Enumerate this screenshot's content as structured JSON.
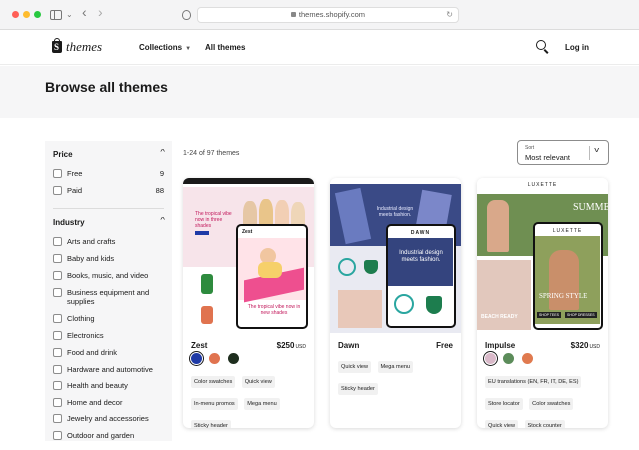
{
  "browser": {
    "url": "themes.shopify.com",
    "icons": [
      "sidebar-toggle-icon",
      "chevron-down-icon",
      "back-arrow-icon",
      "forward-arrow-icon",
      "shield-icon",
      "lock-icon",
      "reload-icon"
    ]
  },
  "header": {
    "logo_text": "themes",
    "nav": [
      {
        "label": "Collections",
        "has_dropdown": true
      },
      {
        "label": "All themes",
        "has_dropdown": false
      }
    ],
    "login_label": "Log in"
  },
  "page": {
    "title": "Browse all themes"
  },
  "filters": {
    "price": {
      "heading": "Price",
      "options": [
        {
          "label": "Free",
          "count": "9"
        },
        {
          "label": "Paid",
          "count": "88"
        }
      ]
    },
    "industry": {
      "heading": "Industry",
      "options": [
        {
          "label": "Arts and crafts"
        },
        {
          "label": "Baby and kids"
        },
        {
          "label": "Books, music, and video"
        },
        {
          "label": "Business equipment and supplies"
        },
        {
          "label": "Clothing"
        },
        {
          "label": "Electronics"
        },
        {
          "label": "Food and drink"
        },
        {
          "label": "Hardware and automotive"
        },
        {
          "label": "Health and beauty"
        },
        {
          "label": "Home and decor"
        },
        {
          "label": "Jewelry and accessories"
        },
        {
          "label": "Outdoor and garden"
        }
      ]
    }
  },
  "results": {
    "count_text": "1-24 of 97 themes",
    "sort": {
      "label": "Sort",
      "value": "Most relevant"
    }
  },
  "themes": [
    {
      "name": "Zest",
      "price": "$250",
      "currency": "USD",
      "swatches": [
        "#1f3aa6",
        "#e0734f",
        "#1e2e1e"
      ],
      "tags": [
        "Color swatches",
        "Quick view",
        "In-menu promos",
        "Mega menu",
        "Sticky header"
      ],
      "preview_text": {
        "hero": "The tropical vibe now in three shades",
        "phone_logo": "Zest",
        "phone_caption": "The tropical vibe now in new shades"
      }
    },
    {
      "name": "Dawn",
      "price": "Free",
      "currency": "",
      "swatches": [],
      "tags": [
        "Quick view",
        "Mega menu",
        "Sticky header"
      ],
      "preview_text": {
        "hero": "Industrial design meets fashion.",
        "phone_logo": "DAWN",
        "phone_caption": "Industrial design meets fashion."
      }
    },
    {
      "name": "Impulse",
      "price": "$320",
      "currency": "USD",
      "swatches": [
        "#d9b9c9",
        "#5c8c5a",
        "#e07a4f"
      ],
      "tags": [
        "EU translations (EN, FR, IT, DE, ES)",
        "Store locator",
        "Color swatches",
        "Quick view",
        "Stock counter"
      ],
      "preview_text": {
        "logo": "LUXETTE",
        "phone_logo": "LUXETTE",
        "hero": "SUMMER",
        "phone_caption": "SPRING STYLE",
        "beach": "BEACH READY",
        "button_a": "SHOP TEES",
        "button_b": "SHOP DRESSES"
      }
    }
  ]
}
